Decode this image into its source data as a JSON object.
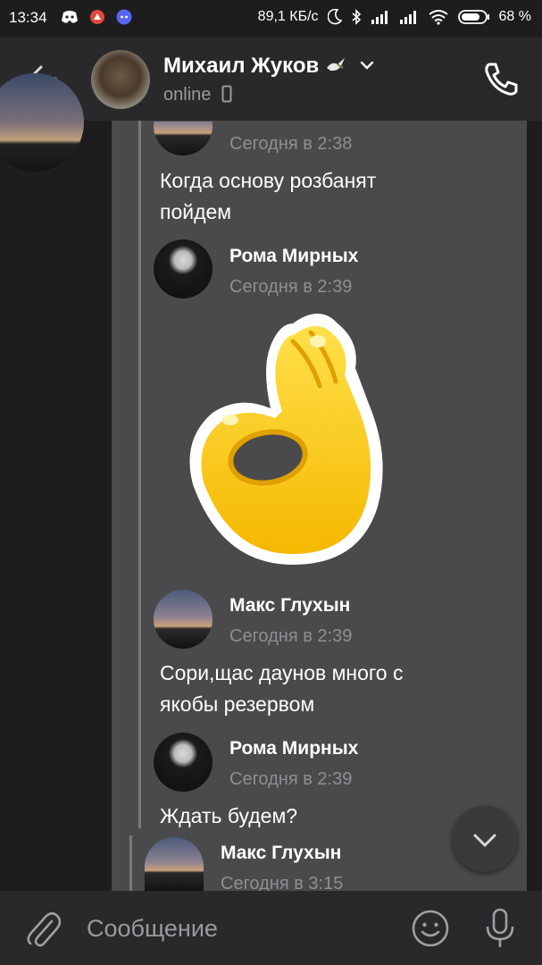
{
  "status_bar": {
    "time": "13:34",
    "speed": "89,1 КБ/с",
    "battery": "68 %"
  },
  "header": {
    "contact_name": "Михаил Жуков",
    "status": "online"
  },
  "messages": [
    {
      "time": "Сегодня в 2:38",
      "text_line1": "Когда основу розбанят",
      "text_line2": "пойдем"
    },
    {
      "sender": "Рома Мирных",
      "time": "Сегодня в 2:39",
      "sticker": "ok-hand-sticker"
    },
    {
      "sender": "Макс Глухын",
      "time": "Сегодня в 2:39",
      "text_line1": "Сори,щас даунов много с",
      "text_line2": "якобы резервом"
    },
    {
      "sender": "Рома Мирных",
      "time": "Сегодня в 2:39",
      "text_line1": "Ждать будем?"
    },
    {
      "sender": "Макс Глухын",
      "time": "Сегодня в 3:15"
    }
  ],
  "composer": {
    "placeholder": "Сообщение"
  },
  "colors": {
    "background": "#1d1d1f",
    "bar": "#29292b",
    "card": "#4a4a4c",
    "muted_text": "#8f8f93"
  }
}
